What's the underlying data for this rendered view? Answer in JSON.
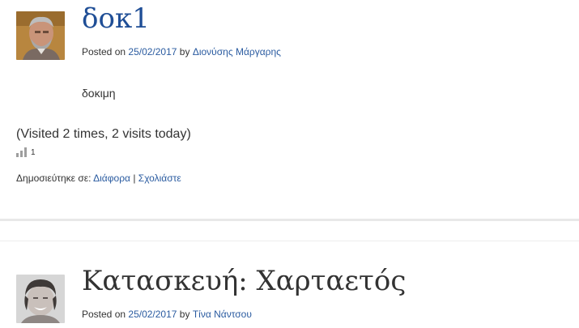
{
  "post1": {
    "title": "δοκ1",
    "posted_on_label": "Posted on",
    "date": "25/02/2017",
    "by_label": "by",
    "author": "Διονύσης Μάργαρης",
    "content": "δοκιμη",
    "visits": "(Visited 2 times, 2 visits today)",
    "stats_count": "1",
    "published_label": "Δημοσιεύτηκε σε:",
    "category": "Διάφορα",
    "separator": "|",
    "comment_link": "Σχολιάστε"
  },
  "post2": {
    "title": "Κατασκευή: Χαρταετός",
    "posted_on_label": "Posted on",
    "date": "25/02/2017",
    "by_label": "by",
    "author": "Τίνα Νάντσου"
  },
  "colors": {
    "link": "#2a5ba0",
    "title_post1": "#1f4e96",
    "title_post2": "#333333",
    "text": "#333333"
  },
  "icons": {
    "stats": "bar-chart-icon"
  }
}
